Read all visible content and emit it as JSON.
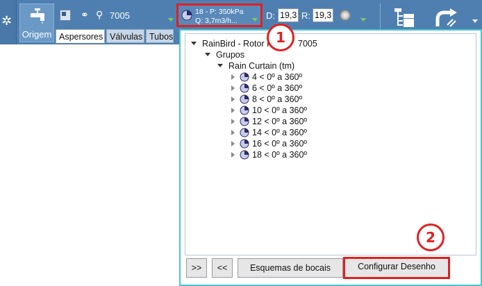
{
  "ribbon": {
    "origem_label": "Origem",
    "sprinkler_id": "7005",
    "tabs": [
      {
        "label": "Aspersores"
      },
      {
        "label": "Válvulas"
      },
      {
        "label": "Tubos"
      }
    ],
    "nozzle": {
      "line1": "18 - P: 350kPa",
      "line2": "Q: 3,7m3/h..."
    },
    "d_label": "D:",
    "d_value": "19,3",
    "r_label": "R:",
    "r_value": "19,3"
  },
  "tree": {
    "root": "RainBird - Rotor R",
    "root_suffix": "7005",
    "groups_label": "Grupos",
    "group_name": "Rain Curtain (tm)",
    "items": [
      "4 < 0º a 360º",
      "6 < 0º a 360º",
      "8 < 0º a 360º",
      "10 < 0º a 360º",
      "12 < 0º a 360º",
      "14 < 0º a 360º",
      "16 < 0º a 360º",
      "18 < 0º a 360º"
    ]
  },
  "buttons": {
    "next": ">>",
    "prev": "<<",
    "schemes": "Esquemas de bocais",
    "configure": "Configurar Desenho"
  },
  "annotations": {
    "badge1": "1",
    "badge2": "2"
  },
  "colors": {
    "ribbon": "#4f7fb0",
    "panel_border": "#49c6ca",
    "highlight": "#e02020"
  }
}
